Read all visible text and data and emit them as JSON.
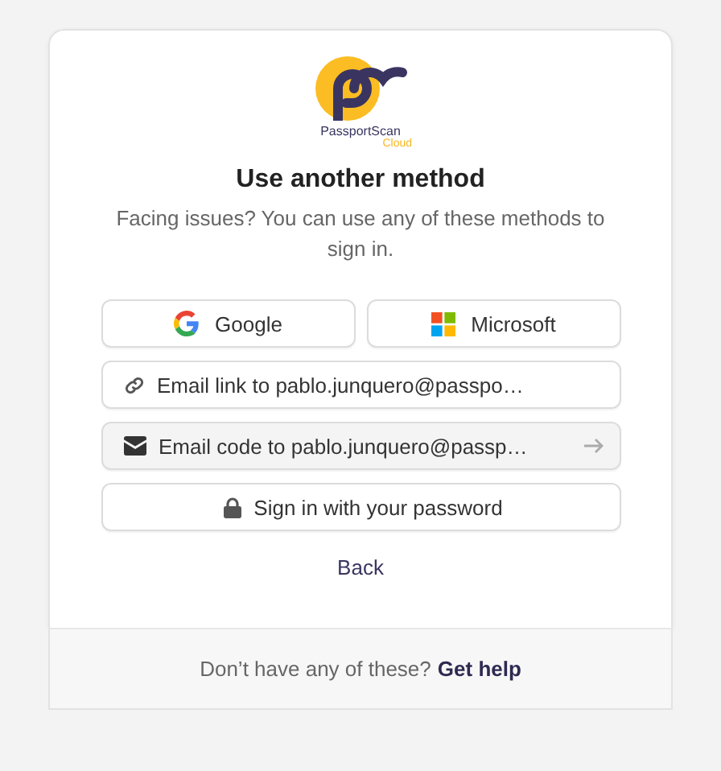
{
  "logo": {
    "name": "PassportScan",
    "sub": "Cloud"
  },
  "heading": "Use another method",
  "subtitle": "Facing issues? You can use any of these methods to sign in.",
  "providers": [
    {
      "kind": "google",
      "label": "Google"
    },
    {
      "kind": "microsoft",
      "label": "Microsoft"
    }
  ],
  "methods": [
    {
      "kind": "link",
      "label": "Email link to pablo.junquero@passpo…",
      "highlighted": false
    },
    {
      "kind": "mail",
      "label": "Email code to pablo.junquero@passp…",
      "highlighted": true
    },
    {
      "kind": "lock",
      "label": "Sign in with your password",
      "highlighted": false
    }
  ],
  "back": "Back",
  "footer": {
    "text": "Don’t have any of these?",
    "link": "Get help"
  }
}
